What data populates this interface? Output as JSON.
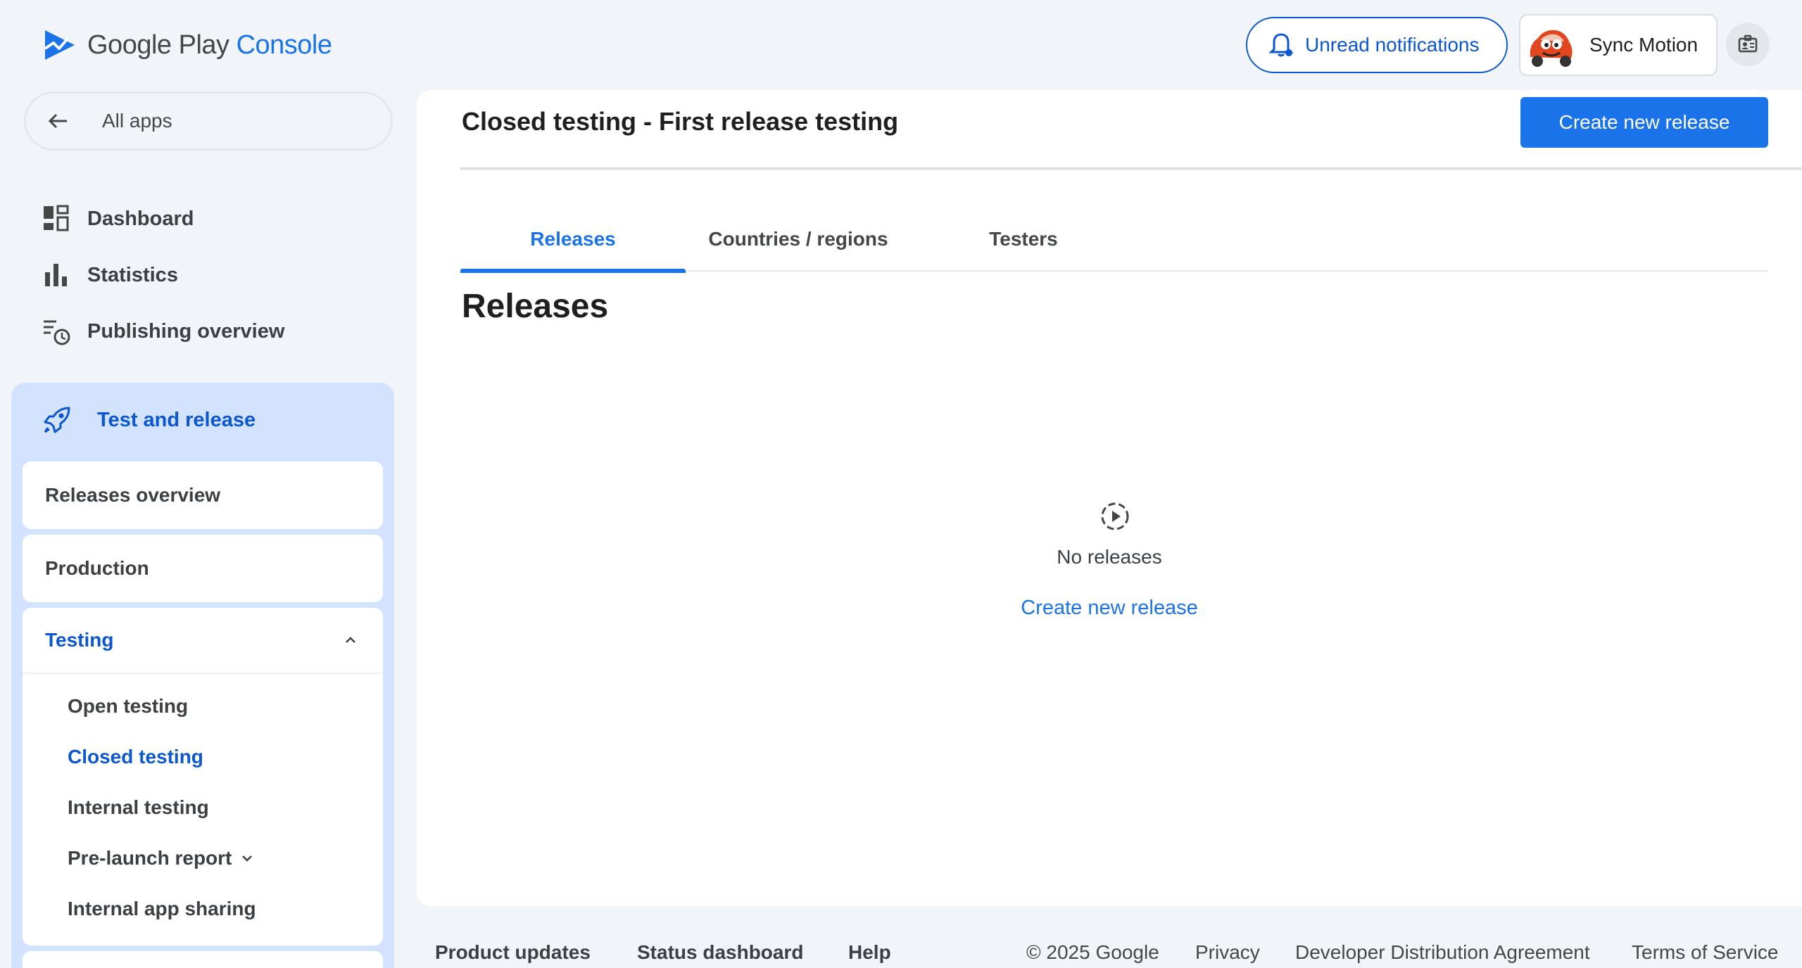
{
  "header": {
    "logo_google": "Google Play",
    "logo_console": "Console",
    "notifications_label": "Unread notifications",
    "account_name": "Sync Motion"
  },
  "sidebar": {
    "all_apps": "All apps",
    "items": [
      {
        "label": "Dashboard",
        "icon": "dashboard-icon"
      },
      {
        "label": "Statistics",
        "icon": "bar-chart-icon"
      },
      {
        "label": "Publishing overview",
        "icon": "publishing-history-icon"
      }
    ],
    "test_release": {
      "label": "Test and release",
      "icon": "rocket-icon",
      "releases_overview": "Releases overview",
      "production": "Production",
      "testing": {
        "label": "Testing",
        "items": [
          "Open testing",
          "Closed testing",
          "Internal testing",
          "Pre-launch report",
          "Internal app sharing"
        ]
      }
    }
  },
  "main": {
    "page_title": "Closed testing - First release testing",
    "create_button": "Create new release",
    "tabs": [
      "Releases",
      "Countries / regions",
      "Testers"
    ],
    "section_title": "Releases",
    "empty_text": "No releases",
    "empty_link": "Create new release"
  },
  "footer": {
    "left": [
      "Product updates",
      "Status dashboard",
      "Help"
    ],
    "right": [
      "© 2025 Google",
      "Privacy",
      "Developer Distribution Agreement",
      "Terms of Service"
    ]
  },
  "colors": {
    "accent": "#1a73e8",
    "accent_dark": "#0b57d0",
    "active_panel": "#d3e3fd",
    "background": "#f1f4f9"
  }
}
